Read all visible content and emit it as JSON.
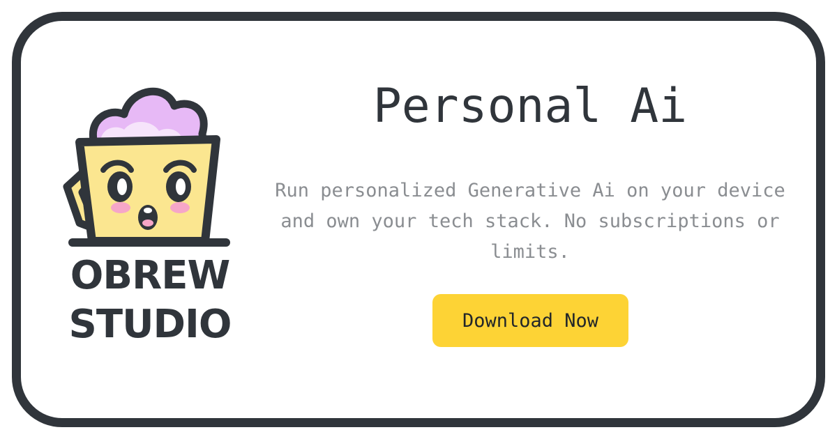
{
  "brand": {
    "line1": "OBREW",
    "line2": "STUDIO",
    "logo_icon": "cup-mascot-icon"
  },
  "hero": {
    "title": "Personal Ai",
    "description": "Run personalized Generative Ai on your device and own your tech stack. No subscriptions or limits.",
    "cta_label": "Download Now"
  },
  "colors": {
    "border": "#30353b",
    "title": "#30353b",
    "description": "#8a8d91",
    "cta_background": "#fdd335",
    "mascot_cup": "#fbe690",
    "mascot_foam": "#e7b9f6",
    "mascot_cheeks": "#f6a6c8"
  }
}
